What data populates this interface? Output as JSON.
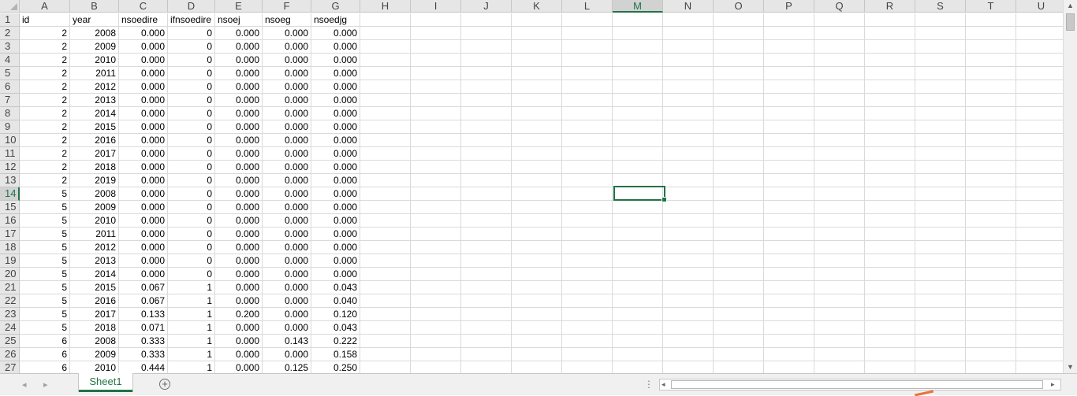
{
  "sheet": {
    "columns": [
      "A",
      "B",
      "C",
      "D",
      "E",
      "F",
      "G",
      "H",
      "I",
      "J",
      "K",
      "L",
      "M",
      "N",
      "O",
      "P",
      "Q",
      "R",
      "S",
      "T",
      "U"
    ],
    "selected_column": "M",
    "selected_row": "14",
    "rows": [
      {
        "n": "1",
        "cells": [
          "id",
          "year",
          "nsoedire",
          "ifnsoedire",
          "nsoej",
          "nsoeg",
          "nsoedjg"
        ]
      },
      {
        "n": "2",
        "cells": [
          "2",
          "2008",
          "0.000",
          "0",
          "0.000",
          "0.000",
          "0.000"
        ]
      },
      {
        "n": "3",
        "cells": [
          "2",
          "2009",
          "0.000",
          "0",
          "0.000",
          "0.000",
          "0.000"
        ]
      },
      {
        "n": "4",
        "cells": [
          "2",
          "2010",
          "0.000",
          "0",
          "0.000",
          "0.000",
          "0.000"
        ]
      },
      {
        "n": "5",
        "cells": [
          "2",
          "2011",
          "0.000",
          "0",
          "0.000",
          "0.000",
          "0.000"
        ]
      },
      {
        "n": "6",
        "cells": [
          "2",
          "2012",
          "0.000",
          "0",
          "0.000",
          "0.000",
          "0.000"
        ]
      },
      {
        "n": "7",
        "cells": [
          "2",
          "2013",
          "0.000",
          "0",
          "0.000",
          "0.000",
          "0.000"
        ]
      },
      {
        "n": "8",
        "cells": [
          "2",
          "2014",
          "0.000",
          "0",
          "0.000",
          "0.000",
          "0.000"
        ]
      },
      {
        "n": "9",
        "cells": [
          "2",
          "2015",
          "0.000",
          "0",
          "0.000",
          "0.000",
          "0.000"
        ]
      },
      {
        "n": "10",
        "cells": [
          "2",
          "2016",
          "0.000",
          "0",
          "0.000",
          "0.000",
          "0.000"
        ]
      },
      {
        "n": "11",
        "cells": [
          "2",
          "2017",
          "0.000",
          "0",
          "0.000",
          "0.000",
          "0.000"
        ]
      },
      {
        "n": "12",
        "cells": [
          "2",
          "2018",
          "0.000",
          "0",
          "0.000",
          "0.000",
          "0.000"
        ]
      },
      {
        "n": "13",
        "cells": [
          "2",
          "2019",
          "0.000",
          "0",
          "0.000",
          "0.000",
          "0.000"
        ]
      },
      {
        "n": "14",
        "cells": [
          "5",
          "2008",
          "0.000",
          "0",
          "0.000",
          "0.000",
          "0.000"
        ]
      },
      {
        "n": "15",
        "cells": [
          "5",
          "2009",
          "0.000",
          "0",
          "0.000",
          "0.000",
          "0.000"
        ]
      },
      {
        "n": "16",
        "cells": [
          "5",
          "2010",
          "0.000",
          "0",
          "0.000",
          "0.000",
          "0.000"
        ]
      },
      {
        "n": "17",
        "cells": [
          "5",
          "2011",
          "0.000",
          "0",
          "0.000",
          "0.000",
          "0.000"
        ]
      },
      {
        "n": "18",
        "cells": [
          "5",
          "2012",
          "0.000",
          "0",
          "0.000",
          "0.000",
          "0.000"
        ]
      },
      {
        "n": "19",
        "cells": [
          "5",
          "2013",
          "0.000",
          "0",
          "0.000",
          "0.000",
          "0.000"
        ]
      },
      {
        "n": "20",
        "cells": [
          "5",
          "2014",
          "0.000",
          "0",
          "0.000",
          "0.000",
          "0.000"
        ]
      },
      {
        "n": "21",
        "cells": [
          "5",
          "2015",
          "0.067",
          "1",
          "0.000",
          "0.000",
          "0.043"
        ]
      },
      {
        "n": "22",
        "cells": [
          "5",
          "2016",
          "0.067",
          "1",
          "0.000",
          "0.000",
          "0.040"
        ]
      },
      {
        "n": "23",
        "cells": [
          "5",
          "2017",
          "0.133",
          "1",
          "0.200",
          "0.000",
          "0.120"
        ]
      },
      {
        "n": "24",
        "cells": [
          "5",
          "2018",
          "0.071",
          "1",
          "0.000",
          "0.000",
          "0.043"
        ]
      },
      {
        "n": "25",
        "cells": [
          "6",
          "2008",
          "0.333",
          "1",
          "0.000",
          "0.143",
          "0.222"
        ]
      },
      {
        "n": "26",
        "cells": [
          "6",
          "2009",
          "0.333",
          "1",
          "0.000",
          "0.000",
          "0.158"
        ]
      },
      {
        "n": "27",
        "cells": [
          "6",
          "2010",
          "0.444",
          "1",
          "0.000",
          "0.125",
          "0.250"
        ]
      }
    ]
  },
  "tabs": {
    "active": "Sheet1",
    "add_symbol": "+"
  },
  "icons": {
    "corner": "select-all-triangle",
    "nav_prev": "◂",
    "nav_next": "▸",
    "scroll_up": "▲",
    "scroll_down": "▼",
    "scroll_left": "◂",
    "scroll_right": "▸",
    "split": "⋮"
  },
  "colors": {
    "accent": "#217346"
  }
}
